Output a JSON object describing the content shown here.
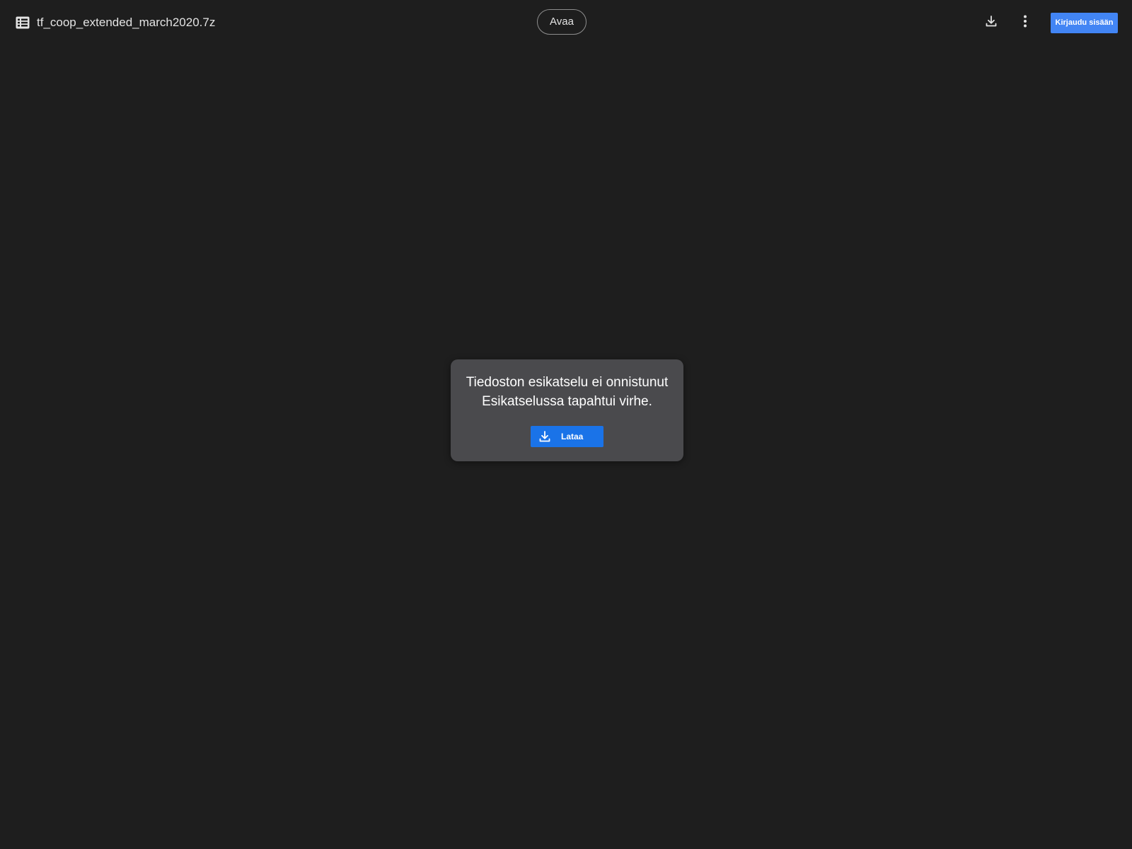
{
  "header": {
    "file_icon": "spreadsheet-list-icon",
    "file_name": "tf_coop_extended_march2020.7z",
    "open_label": "Avaa",
    "download_icon": "download-icon",
    "more_icon": "more-vert-icon",
    "signin_label": "Kirjaudu sisään"
  },
  "preview_error": {
    "title": "Tiedoston esikatselu ei onnistunut",
    "message": "Esikatselussa tapahtui virhe.",
    "download_icon": "download-icon",
    "download_label": "Lataa"
  },
  "colors": {
    "background": "#1e1e1e",
    "dialog_bg": "#4a4a4d",
    "accent_blue": "#1a73e8",
    "signin_blue": "#4285f4"
  }
}
